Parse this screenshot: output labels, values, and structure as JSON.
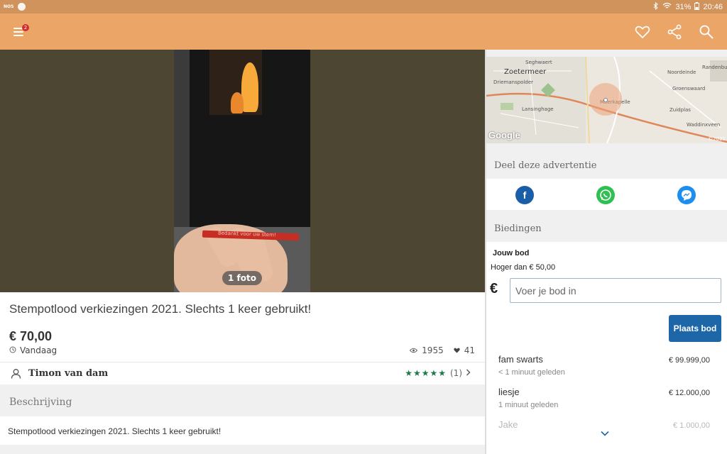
{
  "status_bar": {
    "app_label": "NOS",
    "battery_percent": "31%",
    "time": "20:46"
  },
  "app_bar": {
    "menu_badge": "2",
    "icons": [
      "heart-icon",
      "share-icon",
      "search-icon"
    ]
  },
  "listing": {
    "photo_count": "1 foto",
    "photo_caption": "Bedankt voor uw stem!",
    "title": "Stempotlood verkiezingen 2021. Slechts 1 keer gebruikt!",
    "price": "€ 70,00",
    "date": "Vandaag",
    "views": "1955",
    "favorites": "41",
    "seller": "Timon  van dam",
    "rating_count": "(1)",
    "description_header": "Beschrijving",
    "description": "Stempotlood verkiezingen 2021. Slechts 1 keer gebruikt!"
  },
  "map": {
    "labels": [
      "Seghwaert",
      "Zoetermeer",
      "Driemanspolder",
      "Lansinghage",
      "Moerkapelle",
      "Noordeinde",
      "Randenburg",
      "Groenswaard",
      "Zuidplas",
      "Waddinxveen"
    ],
    "attribution": "Google",
    "copyright": "©2021"
  },
  "share": {
    "header": "Deel deze advertentie",
    "buttons": [
      "facebook-icon",
      "whatsapp-icon",
      "messenger-icon"
    ]
  },
  "bids": {
    "header": "Biedingen",
    "your_bid_label": "Jouw bod",
    "minimum": "Hoger dan € 50,00",
    "currency": "€",
    "input_placeholder": "Voer je bod in",
    "place_bid_label": "Plaats bod",
    "items": [
      {
        "name": "fam swarts",
        "time": "< 1 minuut geleden",
        "amount": "€ 99.999,00"
      },
      {
        "name": "liesje",
        "time": "1 minuut geleden",
        "amount": "€ 12.000,00"
      },
      {
        "name": "Jake",
        "time": "",
        "amount": "€ 1.000,00"
      }
    ]
  },
  "colors": {
    "app_bar": "#eba566",
    "status_bar": "#d1935c",
    "primary_button": "#1d67a8",
    "rating_star": "#1e7a4a"
  }
}
